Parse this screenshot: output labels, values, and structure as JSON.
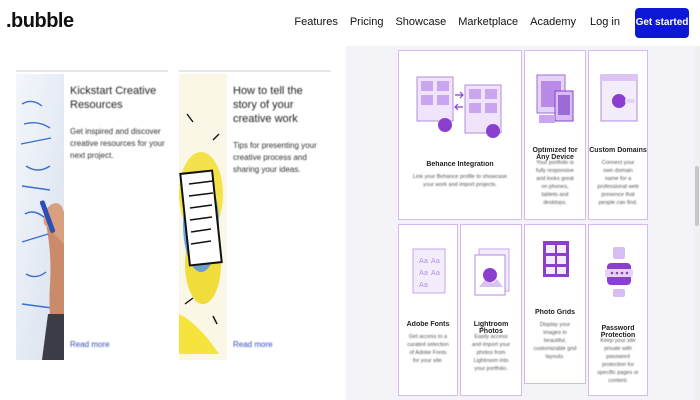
{
  "nav": {
    "logo": ".bubble",
    "links": [
      "Features",
      "Pricing",
      "Showcase",
      "Marketplace",
      "Academy"
    ],
    "login": "Log in",
    "cta": "Get started"
  },
  "colors": {
    "accent": "#0d18d6",
    "purple": "#8a3fcf",
    "tile_border": "#d8b9ef"
  },
  "left_cards": [
    {
      "title": "Kickstart Creative Resources",
      "description": "Get inspired and discover creative resources for your next project.",
      "read_more": "Read more",
      "icon": "whiteboard-photo"
    },
    {
      "title": "How to tell the story of your creative work",
      "description": "Tips for presenting your creative process and sharing your ideas.",
      "read_more": "Read more",
      "icon": "sketch-illustration"
    }
  ],
  "features": [
    {
      "title": "Behance Integration",
      "description": "Link your Behance profile to showcase your work and import projects.",
      "icon": "behance-grid-icon"
    },
    {
      "title": "Optimized for Any Device",
      "description": "Your portfolio is fully responsive and looks great on phones, tablets and desktops.",
      "icon": "devices-icon"
    },
    {
      "title": "Custom Domains",
      "description": "Connect your own domain name for a professional web presence that people can find.",
      "icon": "domain-browser-icon"
    },
    {
      "title": "Adobe Fonts",
      "description": "Get access to a curated selection of Adobe Fonts for your site.",
      "icon": "fonts-icon"
    },
    {
      "title": "Lightroom Photos",
      "description": "Easily access and import your photos from Lightroom into your portfolio.",
      "icon": "lightroom-icon"
    },
    {
      "title": "Photo Grids",
      "description": "Display your images in beautiful, customizable grid layouts.",
      "icon": "photo-grid-icon"
    },
    {
      "title": "Password Protection",
      "description": "Keep your site private with password protection for specific pages or content.",
      "icon": "password-lock-icon"
    }
  ]
}
